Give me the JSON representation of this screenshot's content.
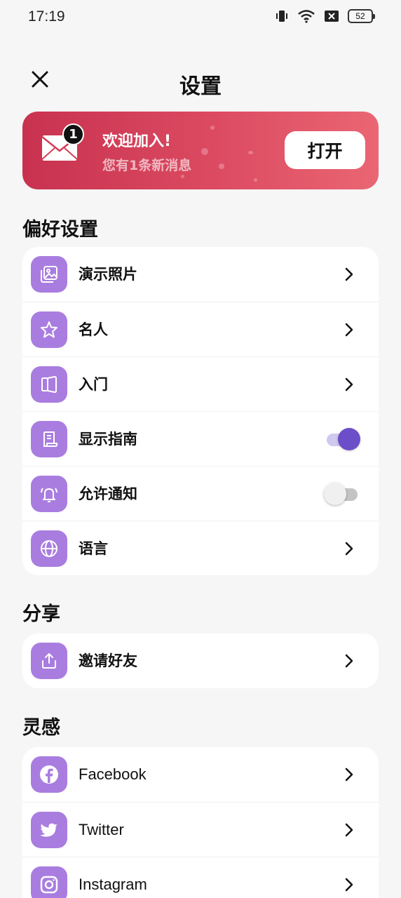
{
  "status": {
    "time": "17:19",
    "battery": "52",
    "icons": [
      "vibrate-icon",
      "wifi-icon",
      "sim-blocked-icon",
      "battery-icon"
    ]
  },
  "header": {
    "title": "设置",
    "close_icon": "close-icon"
  },
  "banner": {
    "title": "欢迎加入!",
    "subtitle": "您有1条新消息",
    "badge_count": "1",
    "button_label": "打开",
    "colors": {
      "start": "#c8324f",
      "end": "#ea6673"
    }
  },
  "sections": {
    "preferences": {
      "title": "偏好设置",
      "items": [
        {
          "label": "演示照片",
          "icon": "image-icon",
          "control": "chevron"
        },
        {
          "label": "名人",
          "icon": "star-icon",
          "control": "chevron"
        },
        {
          "label": "入门",
          "icon": "book-open-icon",
          "control": "chevron"
        },
        {
          "label": "显示指南",
          "icon": "document-icon",
          "control": "toggle",
          "on": true
        },
        {
          "label": "允许通知",
          "icon": "bell-icon",
          "control": "toggle",
          "on": false
        },
        {
          "label": "语言",
          "icon": "globe-icon",
          "control": "chevron"
        }
      ]
    },
    "share": {
      "title": "分享",
      "items": [
        {
          "label": "邀请好友",
          "icon": "share-icon",
          "control": "chevron"
        }
      ]
    },
    "inspiration": {
      "title": "灵感",
      "items": [
        {
          "label": "Facebook",
          "icon": "facebook-icon",
          "control": "chevron"
        },
        {
          "label": "Twitter",
          "icon": "twitter-icon",
          "control": "chevron"
        },
        {
          "label": "Instagram",
          "icon": "instagram-icon",
          "control": "chevron"
        }
      ]
    }
  },
  "colors": {
    "accent": "#a97de0",
    "toggle_on": "#6c4ec9",
    "background": "#f6f6f7"
  }
}
